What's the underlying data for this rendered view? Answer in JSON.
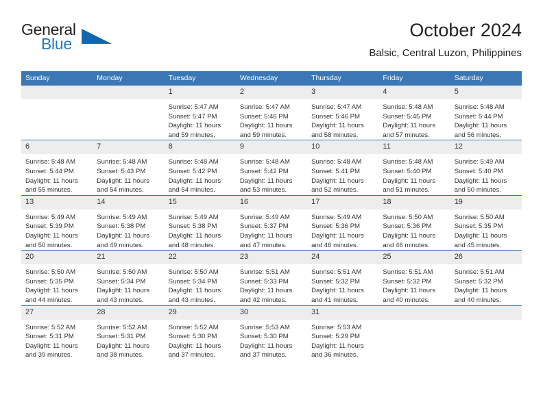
{
  "brand": {
    "name_part1": "General",
    "name_part2": "Blue",
    "triangle_icon": "triangle-icon",
    "colors": {
      "dark": "#231f20",
      "blue": "#1f7ac0",
      "triangle": "#1167ad"
    }
  },
  "header": {
    "title": "October 2024",
    "subtitle": "Balsic, Central Luzon, Philippines"
  },
  "theme": {
    "header_blue": "#3b77b5",
    "daynum_band": "#ededed",
    "text": "#333333"
  },
  "weekday_headers": [
    "Sunday",
    "Monday",
    "Tuesday",
    "Wednesday",
    "Thursday",
    "Friday",
    "Saturday"
  ],
  "weeks": [
    [
      {
        "day": "",
        "empty": true,
        "sunrise": "",
        "sunset": "",
        "daylight1": "",
        "daylight2": ""
      },
      {
        "day": "",
        "empty": true,
        "sunrise": "",
        "sunset": "",
        "daylight1": "",
        "daylight2": ""
      },
      {
        "day": "1",
        "sunrise": "Sunrise: 5:47 AM",
        "sunset": "Sunset: 5:47 PM",
        "daylight1": "Daylight: 11 hours",
        "daylight2": "and 59 minutes."
      },
      {
        "day": "2",
        "sunrise": "Sunrise: 5:47 AM",
        "sunset": "Sunset: 5:46 PM",
        "daylight1": "Daylight: 11 hours",
        "daylight2": "and 59 minutes."
      },
      {
        "day": "3",
        "sunrise": "Sunrise: 5:47 AM",
        "sunset": "Sunset: 5:46 PM",
        "daylight1": "Daylight: 11 hours",
        "daylight2": "and 58 minutes."
      },
      {
        "day": "4",
        "sunrise": "Sunrise: 5:48 AM",
        "sunset": "Sunset: 5:45 PM",
        "daylight1": "Daylight: 11 hours",
        "daylight2": "and 57 minutes."
      },
      {
        "day": "5",
        "sunrise": "Sunrise: 5:48 AM",
        "sunset": "Sunset: 5:44 PM",
        "daylight1": "Daylight: 11 hours",
        "daylight2": "and 56 minutes."
      }
    ],
    [
      {
        "day": "6",
        "sunrise": "Sunrise: 5:48 AM",
        "sunset": "Sunset: 5:44 PM",
        "daylight1": "Daylight: 11 hours",
        "daylight2": "and 55 minutes."
      },
      {
        "day": "7",
        "sunrise": "Sunrise: 5:48 AM",
        "sunset": "Sunset: 5:43 PM",
        "daylight1": "Daylight: 11 hours",
        "daylight2": "and 54 minutes."
      },
      {
        "day": "8",
        "sunrise": "Sunrise: 5:48 AM",
        "sunset": "Sunset: 5:42 PM",
        "daylight1": "Daylight: 11 hours",
        "daylight2": "and 54 minutes."
      },
      {
        "day": "9",
        "sunrise": "Sunrise: 5:48 AM",
        "sunset": "Sunset: 5:42 PM",
        "daylight1": "Daylight: 11 hours",
        "daylight2": "and 53 minutes."
      },
      {
        "day": "10",
        "sunrise": "Sunrise: 5:48 AM",
        "sunset": "Sunset: 5:41 PM",
        "daylight1": "Daylight: 11 hours",
        "daylight2": "and 52 minutes."
      },
      {
        "day": "11",
        "sunrise": "Sunrise: 5:48 AM",
        "sunset": "Sunset: 5:40 PM",
        "daylight1": "Daylight: 11 hours",
        "daylight2": "and 51 minutes."
      },
      {
        "day": "12",
        "sunrise": "Sunrise: 5:49 AM",
        "sunset": "Sunset: 5:40 PM",
        "daylight1": "Daylight: 11 hours",
        "daylight2": "and 50 minutes."
      }
    ],
    [
      {
        "day": "13",
        "sunrise": "Sunrise: 5:49 AM",
        "sunset": "Sunset: 5:39 PM",
        "daylight1": "Daylight: 11 hours",
        "daylight2": "and 50 minutes."
      },
      {
        "day": "14",
        "sunrise": "Sunrise: 5:49 AM",
        "sunset": "Sunset: 5:38 PM",
        "daylight1": "Daylight: 11 hours",
        "daylight2": "and 49 minutes."
      },
      {
        "day": "15",
        "sunrise": "Sunrise: 5:49 AM",
        "sunset": "Sunset: 5:38 PM",
        "daylight1": "Daylight: 11 hours",
        "daylight2": "and 48 minutes."
      },
      {
        "day": "16",
        "sunrise": "Sunrise: 5:49 AM",
        "sunset": "Sunset: 5:37 PM",
        "daylight1": "Daylight: 11 hours",
        "daylight2": "and 47 minutes."
      },
      {
        "day": "17",
        "sunrise": "Sunrise: 5:49 AM",
        "sunset": "Sunset: 5:36 PM",
        "daylight1": "Daylight: 11 hours",
        "daylight2": "and 46 minutes."
      },
      {
        "day": "18",
        "sunrise": "Sunrise: 5:50 AM",
        "sunset": "Sunset: 5:36 PM",
        "daylight1": "Daylight: 11 hours",
        "daylight2": "and 46 minutes."
      },
      {
        "day": "19",
        "sunrise": "Sunrise: 5:50 AM",
        "sunset": "Sunset: 5:35 PM",
        "daylight1": "Daylight: 11 hours",
        "daylight2": "and 45 minutes."
      }
    ],
    [
      {
        "day": "20",
        "sunrise": "Sunrise: 5:50 AM",
        "sunset": "Sunset: 5:35 PM",
        "daylight1": "Daylight: 11 hours",
        "daylight2": "and 44 minutes."
      },
      {
        "day": "21",
        "sunrise": "Sunrise: 5:50 AM",
        "sunset": "Sunset: 5:34 PM",
        "daylight1": "Daylight: 11 hours",
        "daylight2": "and 43 minutes."
      },
      {
        "day": "22",
        "sunrise": "Sunrise: 5:50 AM",
        "sunset": "Sunset: 5:34 PM",
        "daylight1": "Daylight: 11 hours",
        "daylight2": "and 43 minutes."
      },
      {
        "day": "23",
        "sunrise": "Sunrise: 5:51 AM",
        "sunset": "Sunset: 5:33 PM",
        "daylight1": "Daylight: 11 hours",
        "daylight2": "and 42 minutes."
      },
      {
        "day": "24",
        "sunrise": "Sunrise: 5:51 AM",
        "sunset": "Sunset: 5:32 PM",
        "daylight1": "Daylight: 11 hours",
        "daylight2": "and 41 minutes."
      },
      {
        "day": "25",
        "sunrise": "Sunrise: 5:51 AM",
        "sunset": "Sunset: 5:32 PM",
        "daylight1": "Daylight: 11 hours",
        "daylight2": "and 40 minutes."
      },
      {
        "day": "26",
        "sunrise": "Sunrise: 5:51 AM",
        "sunset": "Sunset: 5:32 PM",
        "daylight1": "Daylight: 11 hours",
        "daylight2": "and 40 minutes."
      }
    ],
    [
      {
        "day": "27",
        "sunrise": "Sunrise: 5:52 AM",
        "sunset": "Sunset: 5:31 PM",
        "daylight1": "Daylight: 11 hours",
        "daylight2": "and 39 minutes."
      },
      {
        "day": "28",
        "sunrise": "Sunrise: 5:52 AM",
        "sunset": "Sunset: 5:31 PM",
        "daylight1": "Daylight: 11 hours",
        "daylight2": "and 38 minutes."
      },
      {
        "day": "29",
        "sunrise": "Sunrise: 5:52 AM",
        "sunset": "Sunset: 5:30 PM",
        "daylight1": "Daylight: 11 hours",
        "daylight2": "and 37 minutes."
      },
      {
        "day": "30",
        "sunrise": "Sunrise: 5:53 AM",
        "sunset": "Sunset: 5:30 PM",
        "daylight1": "Daylight: 11 hours",
        "daylight2": "and 37 minutes."
      },
      {
        "day": "31",
        "sunrise": "Sunrise: 5:53 AM",
        "sunset": "Sunset: 5:29 PM",
        "daylight1": "Daylight: 11 hours",
        "daylight2": "and 36 minutes."
      },
      {
        "day": "",
        "empty": true,
        "sunrise": "",
        "sunset": "",
        "daylight1": "",
        "daylight2": ""
      },
      {
        "day": "",
        "empty": true,
        "sunrise": "",
        "sunset": "",
        "daylight1": "",
        "daylight2": ""
      }
    ]
  ]
}
